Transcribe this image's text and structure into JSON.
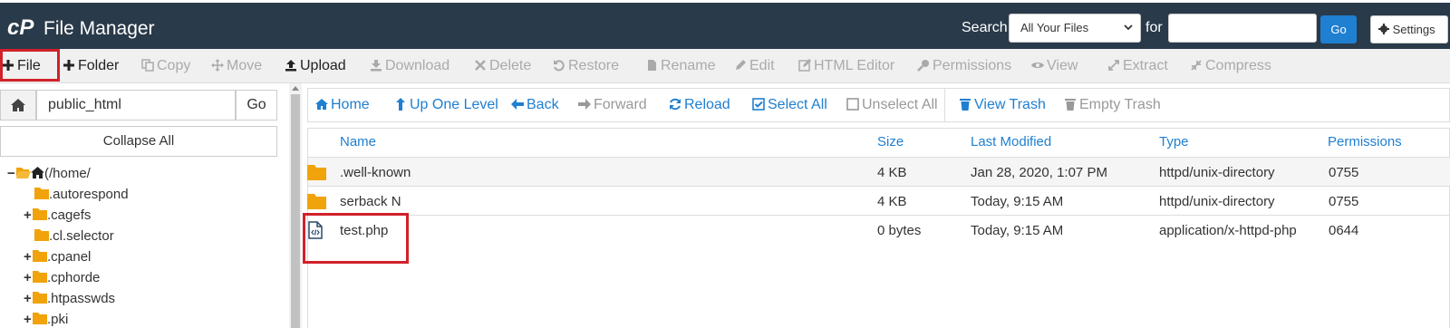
{
  "app": {
    "title": "File Manager"
  },
  "search": {
    "label": "Search",
    "scope": "All Your Files",
    "for_label": "for",
    "query": "",
    "go_label": "Go",
    "settings_label": "Settings"
  },
  "toolbar": {
    "file": "File",
    "folder": "Folder",
    "copy": "Copy",
    "move": "Move",
    "upload": "Upload",
    "download": "Download",
    "delete": "Delete",
    "restore": "Restore",
    "rename": "Rename",
    "edit": "Edit",
    "html_editor": "HTML Editor",
    "permissions": "Permissions",
    "view": "View",
    "extract": "Extract",
    "compress": "Compress"
  },
  "sidebar": {
    "path": "public_html",
    "go_label": "Go",
    "collapse_label": "Collapse All",
    "root_label": "(/home/",
    "tree": [
      {
        "label": ".autorespond",
        "expandable": false
      },
      {
        "label": ".cagefs",
        "expandable": true
      },
      {
        "label": ".cl.selector",
        "expandable": false
      },
      {
        "label": ".cpanel",
        "expandable": true
      },
      {
        "label": ".cphorde",
        "expandable": true
      },
      {
        "label": ".htpasswds",
        "expandable": true
      },
      {
        "label": ".pki",
        "expandable": true
      }
    ]
  },
  "nav": {
    "home": "Home",
    "up_one_level": "Up One Level",
    "back": "Back",
    "forward": "Forward",
    "reload": "Reload",
    "select_all": "Select All",
    "unselect_all": "Unselect All",
    "view_trash": "View Trash",
    "empty_trash": "Empty Trash"
  },
  "table": {
    "columns": {
      "name": "Name",
      "size": "Size",
      "modified": "Last Modified",
      "type": "Type",
      "permissions": "Permissions"
    },
    "rows": [
      {
        "icon": "folder-icon",
        "name": ".well-known",
        "size": "4 KB",
        "modified": "Jan 28, 2020, 1:07 PM",
        "type": "httpd/unix-directory",
        "permissions": "0755"
      },
      {
        "icon": "folder-icon",
        "name": "serback N",
        "size": "4 KB",
        "modified": "Today, 9:15 AM",
        "type": "httpd/unix-directory",
        "permissions": "0755"
      },
      {
        "icon": "code-file-icon",
        "name": "test.php",
        "size": "0 bytes",
        "modified": "Today, 9:15 AM",
        "type": "application/x-httpd-php",
        "permissions": "0644"
      }
    ]
  },
  "colors": {
    "topbar": "#293a4a",
    "accent_blue": "#1f7fd0",
    "folder": "#f0a30a",
    "highlight_red": "#d1212a"
  }
}
